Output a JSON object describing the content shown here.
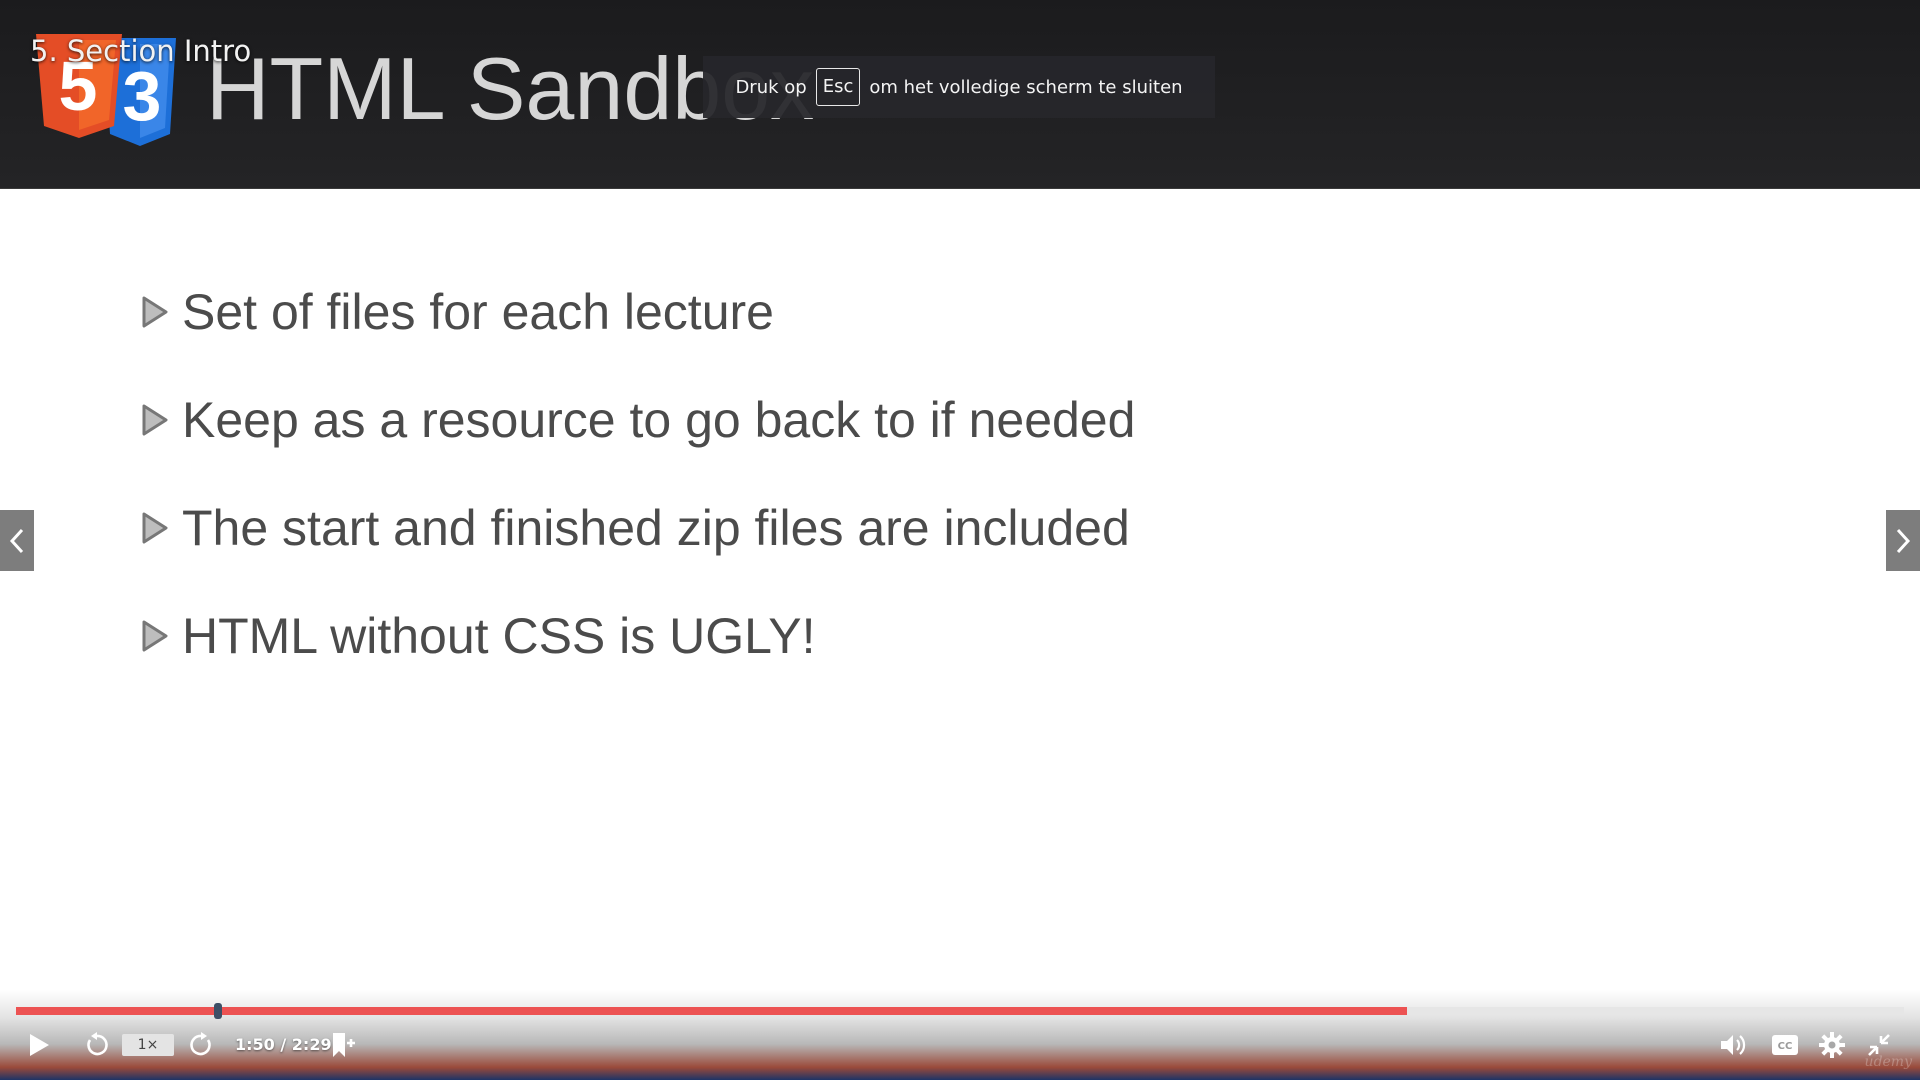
{
  "lecture": {
    "title": "5. Section Intro"
  },
  "slide": {
    "title": "HTML Sandbox",
    "logo_digits": [
      "5",
      "3"
    ],
    "bullets": [
      "Set of files for each lecture",
      "Keep as a resource to go back to if needed",
      "The start and finished zip files are included",
      "HTML without CSS is UGLY!"
    ]
  },
  "fullscreen_hint": {
    "before": "Druk op",
    "key": "Esc",
    "after": "om het volledige scherm te sluiten"
  },
  "player": {
    "speed": "1×",
    "time": "1:50 / 2:29",
    "buffered_fraction": 0.737,
    "played_fraction": 0.107,
    "accent_color": "#ec5252",
    "icons": [
      "play-icon",
      "rewind-icon",
      "forward-icon",
      "bookmark-add-icon",
      "volume-icon",
      "captions-icon",
      "settings-icon",
      "exit-fullscreen-icon"
    ],
    "watermark": "udemy"
  },
  "colors": {
    "html5": "#e44d26",
    "css3": "#1d6fd8",
    "header_bg": "#1f1f21"
  }
}
